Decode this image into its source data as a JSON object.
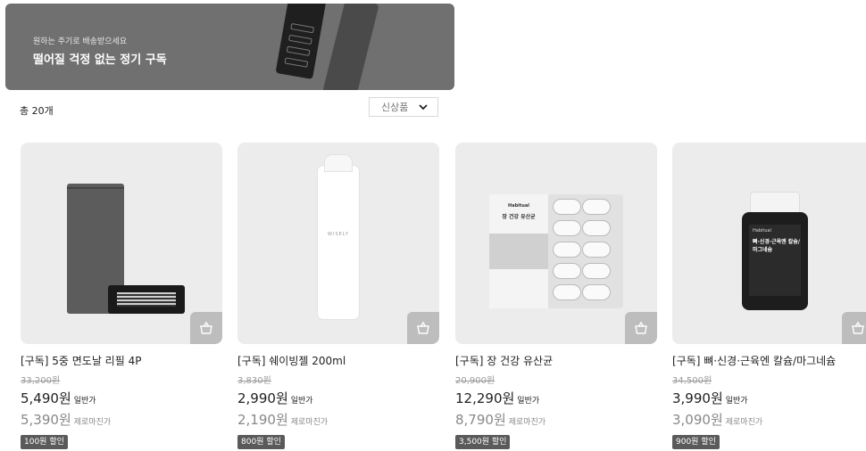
{
  "banner": {
    "subtitle": "원하는 주기로 배송받으세요",
    "title": "떨어질 걱정 없는 정기 구독"
  },
  "list": {
    "total_count": "총 20개",
    "sort_selected": "신상품"
  },
  "labels": {
    "regular": "일반가",
    "zero_margin": "제로마진가"
  },
  "products": [
    {
      "name": "[구독] 5중 면도날 리필 4P",
      "original_price": "33,200원",
      "price": "5,490원",
      "zero_margin_price": "5,390원",
      "badge": "100원 할인"
    },
    {
      "name": "[구독] 쉐이빙젤 200ml",
      "original_price": "3,830원",
      "price": "2,990원",
      "zero_margin_price": "2,190원",
      "badge": "800원 할인",
      "package_brand": "WISELY"
    },
    {
      "name": "[구독] 장 건강 유산균",
      "original_price": "20,900원",
      "price": "12,290원",
      "zero_margin_price": "8,790원",
      "badge": "3,500원 할인",
      "package_brand": "Habitual",
      "package_title": "장 건강 유산균"
    },
    {
      "name": "[구독] 뼈·신경·근육엔 칼슘/마그네슘",
      "original_price": "34,500원",
      "price": "3,990원",
      "zero_margin_price": "3,090원",
      "badge": "900원 할인",
      "package_brand": "Habitual",
      "package_title": "뼈·신경·근육엔 칼슘/마그네슘"
    }
  ],
  "icons": {
    "cart": "shopping-bag-icon",
    "sort": "chevron-down-icon"
  }
}
